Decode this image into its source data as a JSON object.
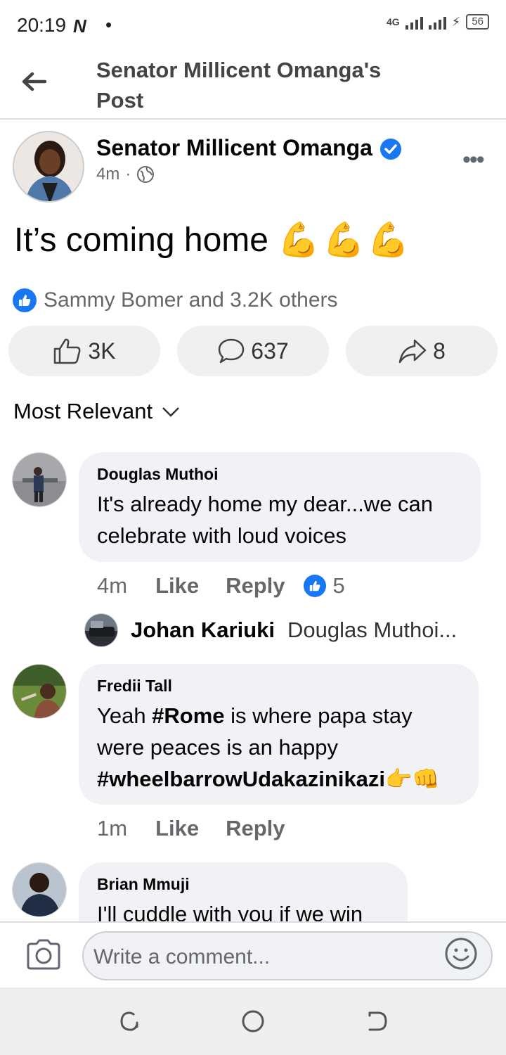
{
  "status": {
    "time": "20:19",
    "network": "4G",
    "battery": "56"
  },
  "header": {
    "title": "Senator Millicent Omanga's Post"
  },
  "post": {
    "author": "Senator Millicent Omanga",
    "time": "4m",
    "text": "It’s coming home",
    "emoji": "💪💪💪",
    "reactions_text": "Sammy Bomer and 3.2K others",
    "like_count": "3K",
    "comment_count": "637",
    "share_count": "8"
  },
  "sort_label": "Most Relevant",
  "comments": [
    {
      "name": "Douglas Muthoi",
      "text": "It's already home my dear...we can celebrate with loud voices",
      "time": "4m",
      "like": "Like",
      "reply": "Reply",
      "reactions": "5"
    },
    {
      "name": "Fredii Tall",
      "text_a": "Yeah ",
      "text_bold1": "#Rome",
      "text_b": " is where papa stay were peaces is an happy ",
      "text_bold2": "#wheelbarrowUdakazinikazi",
      "emoji": "👉👊",
      "time": "1m",
      "like": "Like",
      "reply": "Reply"
    },
    {
      "name": "Brian  Mmuji",
      "text": "I'll cuddle with you if we win"
    }
  ],
  "reply_preview": {
    "name": "Johan Kariuki",
    "text": "Douglas Muthoi..."
  },
  "composer": {
    "placeholder": "Write a comment..."
  },
  "colors": {
    "accent": "#1877f2",
    "bubble": "#f0f2f5",
    "secondary_text": "#65676b"
  }
}
